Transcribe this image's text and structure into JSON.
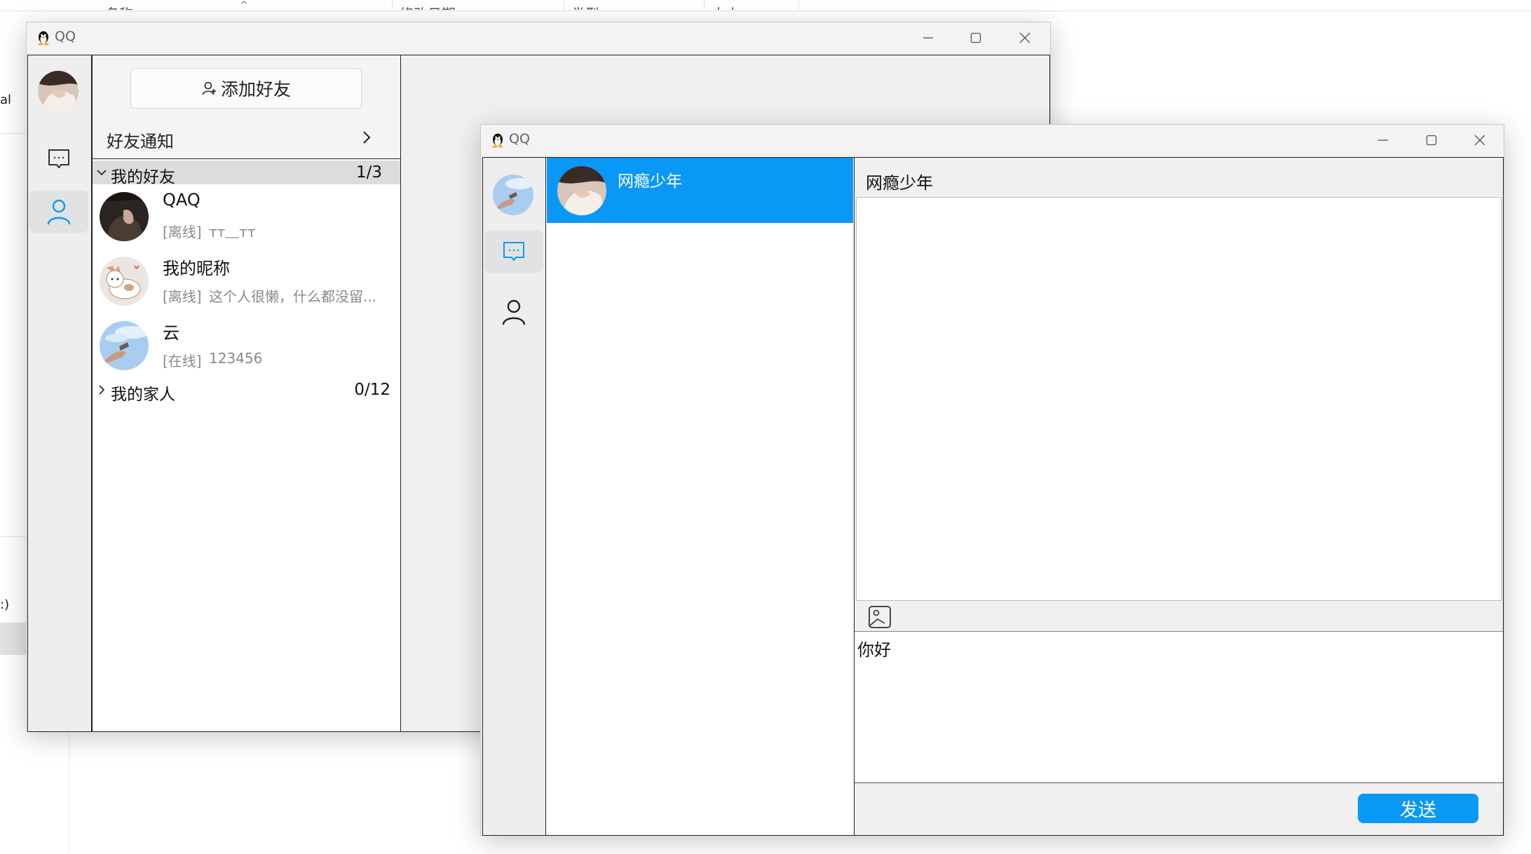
{
  "background": {
    "columns": [
      "名称",
      "修改日期",
      "类型",
      "大小"
    ],
    "side_labels": [
      "al",
      ":)"
    ]
  },
  "contacts_window": {
    "title": "QQ",
    "add_friend_label": "添加好友",
    "friend_notice_label": "好友通知",
    "groups": [
      {
        "name": "我的好友",
        "count": "1/3",
        "expanded": true
      },
      {
        "name": "我的家人",
        "count": "0/12",
        "expanded": false
      }
    ],
    "friends": [
      {
        "name": "QAQ",
        "status": "[离线]",
        "signature": "ᴛᴛ﹏ᴛᴛ"
      },
      {
        "name": "我的昵称",
        "status": "[离线]",
        "signature": "这个人很懒，什么都没留..."
      },
      {
        "name": "云",
        "status": "[在线]",
        "signature": "123456"
      }
    ]
  },
  "chat_window": {
    "title": "QQ",
    "conversations": [
      {
        "name": "网瘾少年",
        "selected": true
      }
    ],
    "chat_header": "网瘾少年",
    "input_text": "你好",
    "send_label": "发送"
  },
  "colors": {
    "accent": "#0a98f7",
    "nav_bg": "#eeeeee",
    "window_bg": "#f0f0f0",
    "group_header_bg": "#dcdcdc"
  }
}
